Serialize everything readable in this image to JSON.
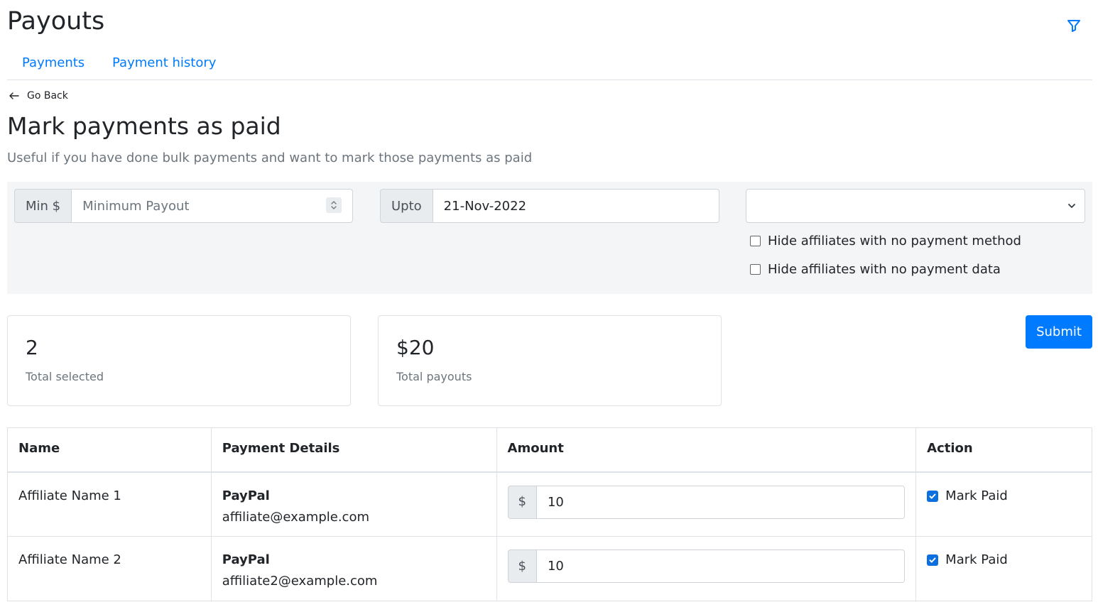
{
  "header": {
    "title": "Payouts",
    "filter_icon": "filter-icon"
  },
  "tabs": [
    {
      "label": "Payments"
    },
    {
      "label": "Payment history"
    }
  ],
  "back": {
    "label": "Go Back",
    "icon": "arrow-left-icon"
  },
  "section": {
    "title": "Mark payments as paid",
    "subtitle": "Useful if you have done bulk payments and want to mark those payments as paid"
  },
  "filters": {
    "min_label": "Min $",
    "min_placeholder": "Minimum Payout",
    "min_value": "",
    "upto_label": "Upto",
    "upto_value": "21-Nov-2022",
    "select_value": "",
    "checkboxes": [
      {
        "label": "Hide affiliates with no payment method",
        "checked": false
      },
      {
        "label": "Hide affiliates with no payment data",
        "checked": false
      }
    ]
  },
  "stats": [
    {
      "value": "2",
      "label": "Total selected"
    },
    {
      "value": "$20",
      "label": "Total payouts"
    }
  ],
  "submit_label": "Submit",
  "table": {
    "headers": [
      "Name",
      "Payment Details",
      "Amount",
      "Action"
    ],
    "rows": [
      {
        "name": "Affiliate Name 1",
        "method": "PayPal",
        "email": "affiliate@example.com",
        "currency": "$",
        "amount": "10",
        "action_label": "Mark Paid",
        "checked": true
      },
      {
        "name": "Affiliate Name 2",
        "method": "PayPal",
        "email": "affiliate2@example.com",
        "currency": "$",
        "amount": "10",
        "action_label": "Mark Paid",
        "checked": true
      }
    ]
  },
  "colors": {
    "primary": "#007bff",
    "panel_bg": "#f4f5f7",
    "muted": "#6c757d"
  }
}
